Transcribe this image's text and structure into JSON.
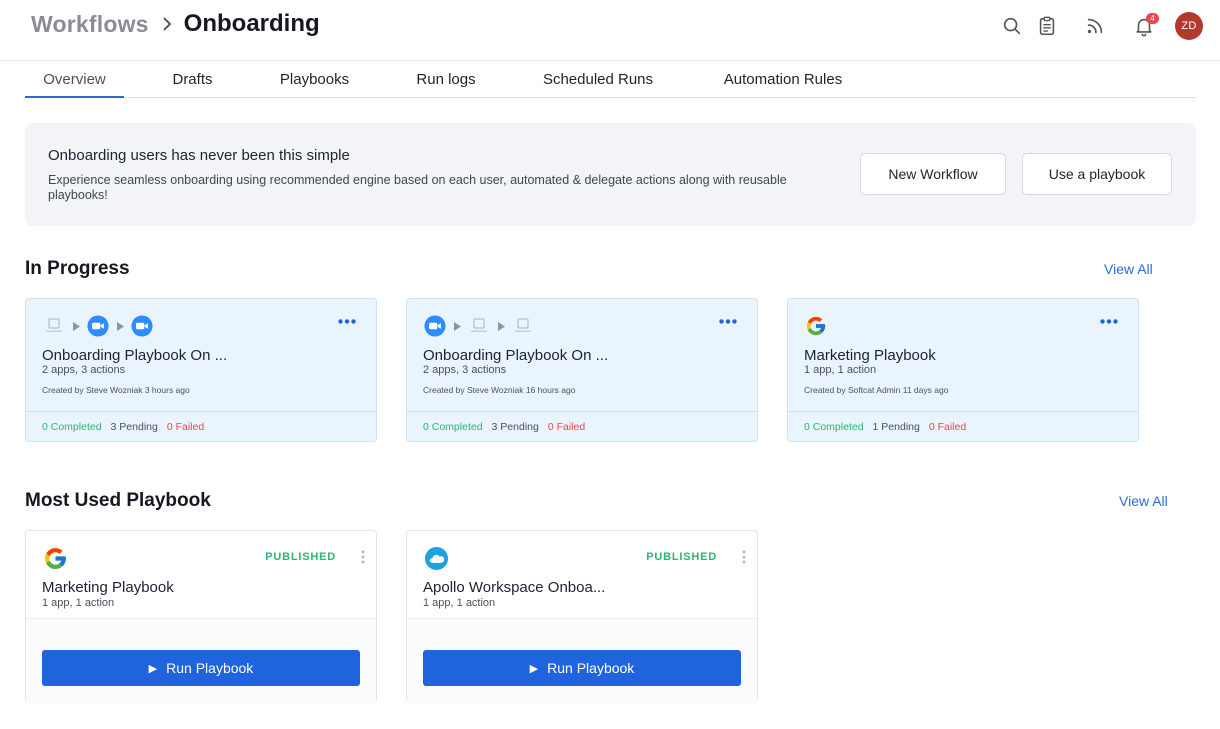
{
  "header": {
    "breadcrumb_root": "Workflows",
    "breadcrumb_current": "Onboarding",
    "icons": [
      "search-icon",
      "clipboard-icon",
      "rss-feed-icon",
      "bell-icon"
    ],
    "notification_count": "4",
    "avatar_initials": "ZD",
    "avatar_color": "#b3392f"
  },
  "tabs": [
    {
      "label": "Overview",
      "active": true
    },
    {
      "label": "Drafts"
    },
    {
      "label": "Playbooks"
    },
    {
      "label": "Run logs"
    },
    {
      "label": "Scheduled Runs"
    },
    {
      "label": "Automation Rules"
    }
  ],
  "banner": {
    "title": "Onboarding users has never been this simple",
    "description": "Experience seamless onboarding using recommended engine based on each user, automated & delegate actions along with reusable playbooks!",
    "new_workflow_label": "New Workflow",
    "use_playbook_label": "Use a playbook"
  },
  "in_progress": {
    "title": "In Progress",
    "view_all_label": "View All",
    "cards": [
      {
        "apps": [
          "calendly-icon",
          "zoom-icon",
          "zoom-icon"
        ],
        "title": "Onboarding Playbook On ...",
        "subtitle": "2 apps, 3 actions",
        "meta": "Created by Steve Wozniak 3 hours ago",
        "completed": "0 Completed",
        "pending": "3 Pending",
        "failed": "0 Failed"
      },
      {
        "apps": [
          "zoom-icon",
          "calendly-icon",
          "calendly-icon"
        ],
        "title": "Onboarding Playbook On ...",
        "subtitle": "2 apps, 3 actions",
        "meta": "Created by Steve Wozniak 16 hours ago",
        "completed": "0 Completed",
        "pending": "3 Pending",
        "failed": "0 Failed"
      },
      {
        "apps": [
          "google-icon"
        ],
        "title": "Marketing Playbook",
        "subtitle": "1 app, 1 action",
        "meta": "Created by Softcat Admin 11 days ago",
        "completed": "0 Completed",
        "pending": "1 Pending",
        "failed": "0 Failed"
      }
    ]
  },
  "most_used": {
    "title": "Most Used Playbook",
    "view_all_label": "View All",
    "cards": [
      {
        "logo": "google-icon",
        "status": "PUBLISHED",
        "title": "Marketing Playbook",
        "subtitle": "1 app, 1 action",
        "button_label": "Run Playbook"
      },
      {
        "logo": "salesforce-icon",
        "status": "PUBLISHED",
        "title": "Apollo Workspace Onboa...",
        "subtitle": "1 app, 1 action",
        "button_label": "Run Playbook"
      }
    ]
  },
  "colors": {
    "accent": "#1f63dd",
    "link": "#2c6bd6",
    "success": "#2bb673",
    "danger": "#e5484d",
    "card_bg": "#eaf4fc"
  }
}
